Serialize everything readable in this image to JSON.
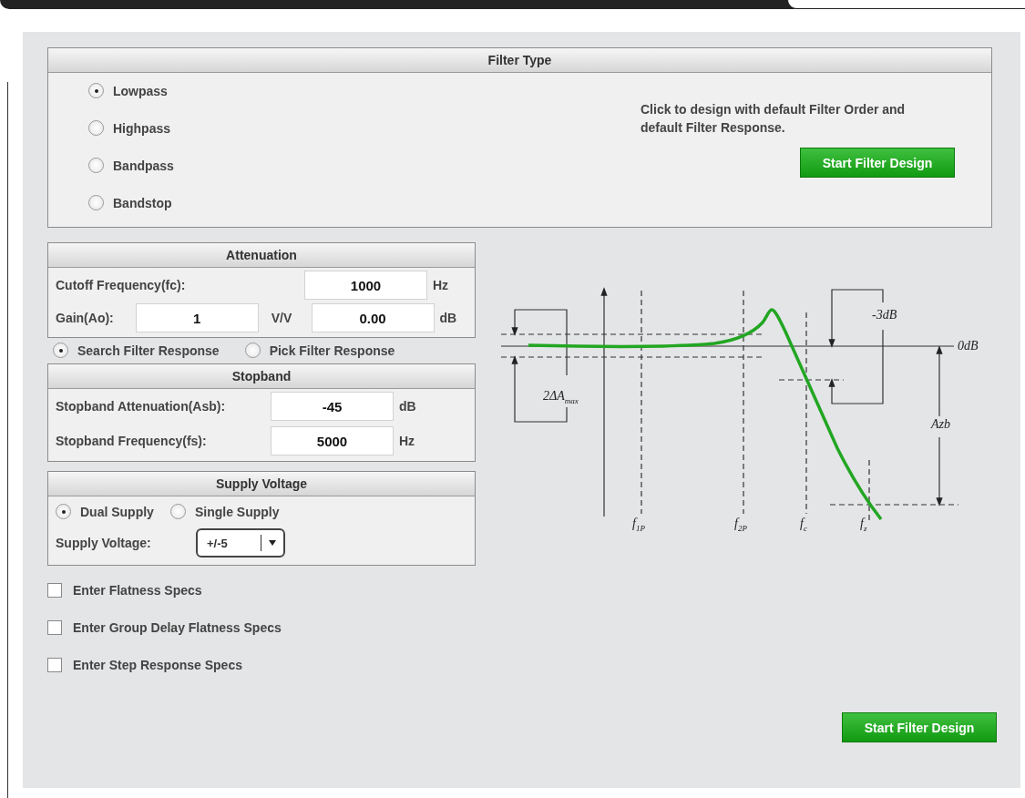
{
  "filter_type": {
    "title": "Filter Type",
    "options": [
      {
        "label": "Lowpass",
        "selected": true
      },
      {
        "label": "Highpass",
        "selected": false
      },
      {
        "label": "Bandpass",
        "selected": false
      },
      {
        "label": "Bandstop",
        "selected": false
      }
    ],
    "hint": "Click to design with default Filter Order and default Filter Response.",
    "button": "Start Filter Design"
  },
  "attenuation": {
    "title": "Attenuation",
    "cutoff": {
      "label": "Cutoff Frequency(fc):",
      "value": "1000",
      "unit": "Hz"
    },
    "gain": {
      "label": "Gain(Ao):",
      "value": "1",
      "unit": "V/V",
      "db_value": "0.00",
      "db_unit": "dB"
    }
  },
  "response_mode": [
    {
      "label": "Search Filter Response",
      "selected": true
    },
    {
      "label": "Pick Filter Response",
      "selected": false
    }
  ],
  "stopband": {
    "title": "Stopband",
    "fields": [
      {
        "label": "Stopband Attenuation(Asb):",
        "value": "-45",
        "unit": "dB"
      },
      {
        "label": "Stopband Frequency(fs):",
        "value": "5000",
        "unit": "Hz"
      }
    ]
  },
  "supply_voltage": {
    "title": "Supply Voltage",
    "supply_type": [
      {
        "label": "Dual Supply",
        "selected": true
      },
      {
        "label": "Single Supply",
        "selected": false
      }
    ],
    "voltage": {
      "label": "Supply Voltage:",
      "value": "+/-5"
    }
  },
  "specs": [
    {
      "label": "Enter Flatness Specs",
      "checked": false
    },
    {
      "label": "Enter Group Delay Flatness Specs",
      "checked": false
    },
    {
      "label": "Enter Step Response Specs",
      "checked": false
    }
  ],
  "diagram": {
    "labels": [
      "2ΔA$_{max}$",
      "-3dB",
      "0dB",
      "Azb",
      "f$_{1P}$",
      "f$_{2P}$",
      "f$_{c}$",
      "f$_{z}$"
    ]
  },
  "start_button": "Start Filter Design"
}
